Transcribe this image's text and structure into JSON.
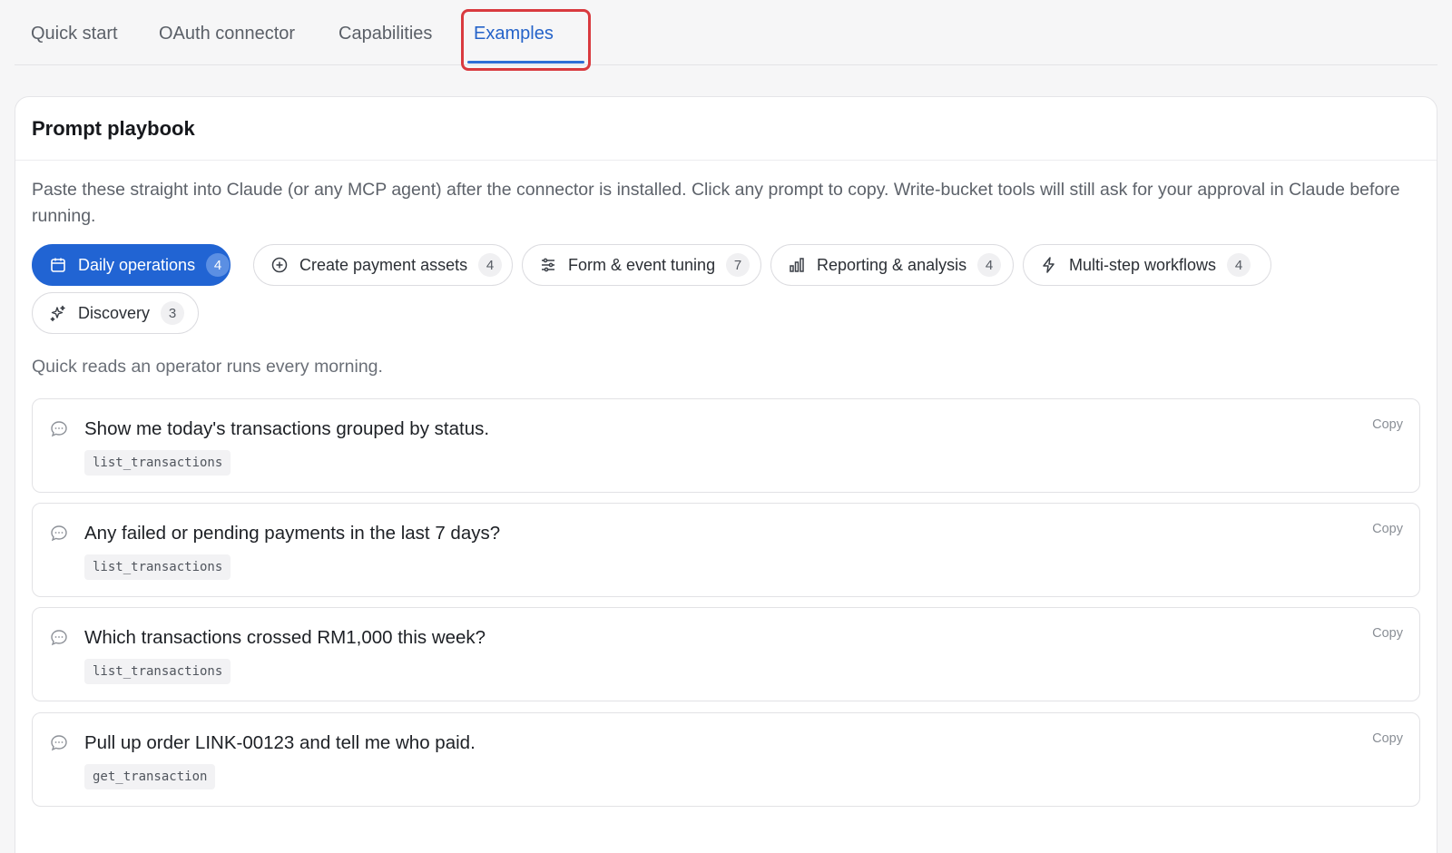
{
  "tabs": [
    {
      "label": "Quick start"
    },
    {
      "label": "OAuth connector"
    },
    {
      "label": "Capabilities"
    },
    {
      "label": "Examples",
      "active": true
    }
  ],
  "card": {
    "title": "Prompt playbook",
    "intro": "Paste these straight into Claude (or any MCP agent) after the connector is installed. Click any prompt to copy. Write-bucket tools will still ask for your approval in Claude before running."
  },
  "filters": [
    {
      "label": "Daily operations",
      "count": "4",
      "icon": "calendar-icon",
      "active": true
    },
    {
      "label": "Create payment assets",
      "count": "4",
      "icon": "plus-circle-icon"
    },
    {
      "label": "Form & event tuning",
      "count": "7",
      "icon": "sliders-icon"
    },
    {
      "label": "Reporting & analysis",
      "count": "4",
      "icon": "bar-chart-icon"
    },
    {
      "label": "Multi-step workflows",
      "count": "4",
      "icon": "lightning-icon"
    },
    {
      "label": "Discovery",
      "count": "3",
      "icon": "sparkles-icon"
    }
  ],
  "section": {
    "description": "Quick reads an operator runs every morning."
  },
  "prompts": [
    {
      "text": "Show me today's transactions grouped by status.",
      "tool": "list_transactions",
      "copy_label": "Copy"
    },
    {
      "text": "Any failed or pending payments in the last 7 days?",
      "tool": "list_transactions",
      "copy_label": "Copy"
    },
    {
      "text": "Which transactions crossed RM1,000 this week?",
      "tool": "list_transactions",
      "copy_label": "Copy"
    },
    {
      "text": "Pull up order LINK-00123 and tell me who paid.",
      "tool": "get_transaction",
      "copy_label": "Copy"
    }
  ],
  "colors": {
    "accent": "#2164d3",
    "highlight_border": "#d93a3f"
  }
}
